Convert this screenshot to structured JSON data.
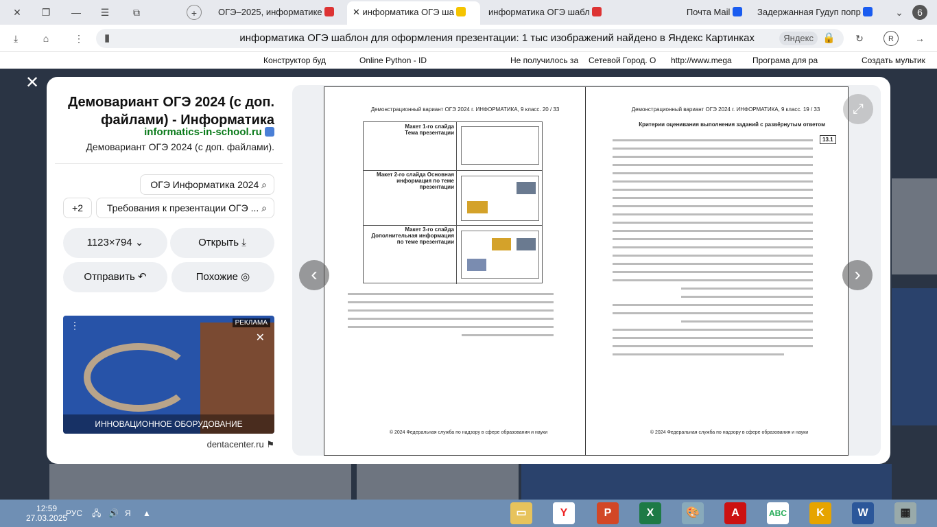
{
  "tabs": [
    {
      "label": "ОГЭ–2025, информатике"
    },
    {
      "label": "информатике"
    },
    {
      "label": "информатика ОГЭ ша",
      "active": true
    },
    {
      "label": "информатика ОГЭ шабл"
    },
    {
      "label": "Почта Mail"
    },
    {
      "label": "Задержанная Гудуп попр"
    },
    {
      "label": "6"
    }
  ],
  "address": {
    "url_title": "информатика ОГЭ шаблон для оформления презентации: 1 тыс изображений найдено в Яндекс Картинках",
    "site_chip": "Яндекс"
  },
  "bookmarks": [
    "Создать мультик",
    "Програмa для ра",
    "http://www.mega",
    "Сетевой Город. О",
    "Не получилось за",
    "Online Python - ID",
    "Конструктор буд"
  ],
  "info": {
    "title": "Демовариант ОГЭ 2024 (с доп. файлами) - Информатика",
    "source": "informatics-in-school.ru",
    "description": "Демовариант ОГЭ 2024 (с доп. файлами).",
    "query_chip": "ОГЭ Информатика 2024",
    "query_chip2": "Требования к презентации ОГЭ ...",
    "more_chip": "+2",
    "open_button": "Открыть",
    "size_button": "1123×794",
    "similar_button": "Похожие",
    "share_button": "Отправить"
  },
  "ad": {
    "badge": "РЕКЛАМА",
    "caption": "ИННОВАЦИОННОЕ ОБОРУДОВАНИЕ",
    "domain": "dentacenter.ru"
  },
  "doc": {
    "left_header": "Демонстрационный вариант ОГЭ 2024 г.   ИНФОРМАТИКА, 9 класс.   20 / 33",
    "right_header": "Демонстрационный вариант ОГЭ 2024 г.   ИНФОРМАТИКА, 9 класс.   19 / 33",
    "right_heading": "Критерии оценивания выполнения заданий с развёрнутым ответом",
    "task_no": "13.1",
    "slide1": "Макет 1-го слайда Тема презентации",
    "slide2": "Макет 2-го слайда Основная информация по теме презентации",
    "slide3": "Макет 3-го слайда Дополнительная информация по теме презентации",
    "footer": "© 2024 Федеральная служба по надзору в сфере образования и науки"
  },
  "taskbar": {
    "time": "12:59",
    "date": "27.03.2025",
    "lang": "РУС"
  },
  "colors": {
    "accent": "#ffcc00",
    "taskbar": "#6f8fb4",
    "source_green": "#0a7a1a"
  }
}
